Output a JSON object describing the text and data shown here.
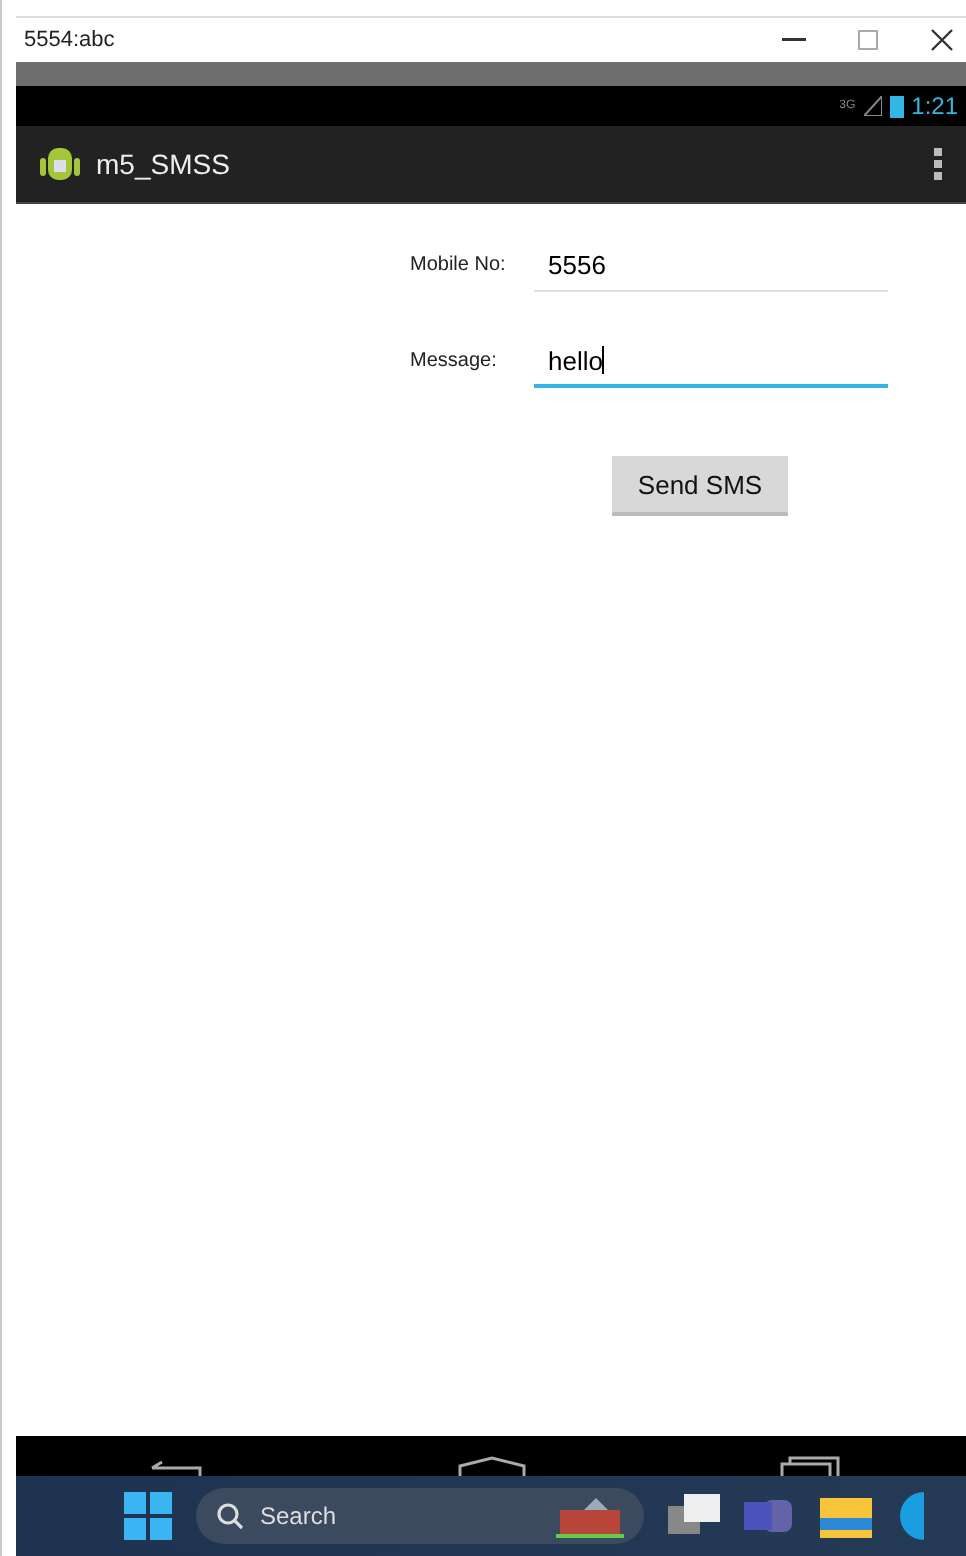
{
  "window": {
    "title": "5554:abc"
  },
  "status_bar": {
    "network": "3G",
    "time": "1:21"
  },
  "action_bar": {
    "title": "m5_SMSS"
  },
  "form": {
    "fields": [
      {
        "label": "Mobile No:",
        "value": "5556",
        "focused": false
      },
      {
        "label": "Message:",
        "value": "hello",
        "focused": true
      }
    ],
    "button": "Send SMS"
  },
  "taskbar": {
    "search_placeholder": "Search"
  }
}
